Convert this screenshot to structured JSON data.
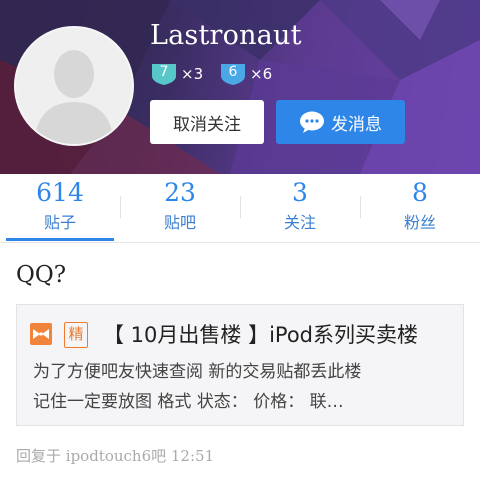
{
  "profile": {
    "username": "Lastronaut",
    "badges": [
      {
        "level": "7",
        "count": "×3",
        "color": "#58c7c9"
      },
      {
        "level": "6",
        "count": "×6",
        "color": "#4aa8e6"
      }
    ],
    "unfollow_label": "取消关注",
    "message_label": "发消息",
    "avatar_icon": "default-user-silhouette"
  },
  "stats": [
    {
      "value": "614",
      "label": "贴子"
    },
    {
      "value": "23",
      "label": "贴吧"
    },
    {
      "value": "3",
      "label": "关注"
    },
    {
      "value": "8",
      "label": "粉丝"
    }
  ],
  "post": {
    "title": "QQ?",
    "quote": {
      "tag": "精",
      "title": "【 10月出售楼 】iPod系列买卖楼",
      "lines": [
        "为了方便吧友快速查阅  新的交易贴都丢此楼",
        "记住一定要放图  格式  状态：   价格：   联…"
      ]
    },
    "reply_meta": "回复于 ipodtouch6吧 12:51"
  },
  "colors": {
    "accent": "#2e87e8",
    "orange": "#ef7b2c",
    "banner_dark": "#2a2247",
    "banner_purple": "#6a43a8"
  }
}
